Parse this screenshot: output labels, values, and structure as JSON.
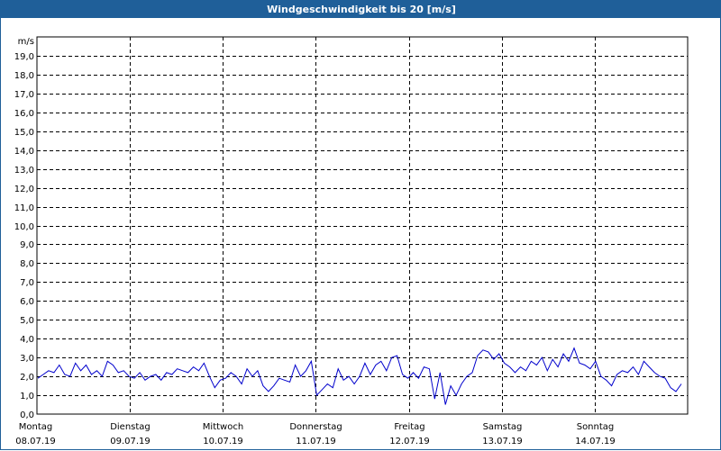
{
  "window": {
    "title": "Windgeschwindigkeit bis 20 [m/s]"
  },
  "colors": {
    "titlebar": "#1f5f99",
    "series": "#0000cc",
    "grid": "#000000"
  },
  "chart_data": {
    "type": "line",
    "title": "Windgeschwindigkeit bis 20 [m/s]",
    "ylabel": "m/s",
    "ylim": [
      0,
      20
    ],
    "yticks": [
      "0,0",
      "1,0",
      "2,0",
      "3,0",
      "4,0",
      "5,0",
      "6,0",
      "7,0",
      "8,0",
      "9,0",
      "10,0",
      "11,0",
      "12,0",
      "13,0",
      "14,0",
      "15,0",
      "16,0",
      "17,0",
      "18,0",
      "19,0"
    ],
    "grid": true,
    "x_days": [
      {
        "day": "Montag",
        "date": "08.07.19"
      },
      {
        "day": "Dienstag",
        "date": "09.07.19"
      },
      {
        "day": "Mittwoch",
        "date": "10.07.19"
      },
      {
        "day": "Donnerstag",
        "date": "11.07.19"
      },
      {
        "day": "Freitag",
        "date": "12.07.19"
      },
      {
        "day": "Samstag",
        "date": "13.07.19"
      },
      {
        "day": "Sonntag",
        "date": "14.07.19"
      }
    ],
    "series": [
      {
        "values": [
          1.9,
          2.1,
          2.3,
          2.2,
          2.6,
          2.1,
          2.0,
          2.7,
          2.3,
          2.6,
          2.1,
          2.3,
          2.0,
          2.8,
          2.6,
          2.2,
          2.3,
          2.0,
          1.9,
          2.2,
          1.8,
          2.0,
          2.1,
          1.8,
          2.2,
          2.1,
          2.4,
          2.3,
          2.2,
          2.5,
          2.3,
          2.7,
          2.0,
          1.4,
          1.8,
          1.9,
          2.2,
          2.0,
          1.6,
          2.4,
          2.0,
          2.3,
          1.5,
          1.2,
          1.5,
          1.9,
          1.8,
          1.7,
          2.6,
          2.0,
          2.3,
          2.8,
          1.0,
          1.3,
          1.6,
          1.4,
          2.4,
          1.8,
          2.0,
          1.6,
          2.0,
          2.7,
          2.1,
          2.6,
          2.8,
          2.3,
          3.0,
          3.1,
          2.1,
          1.9,
          2.2,
          1.9,
          2.5,
          2.4,
          0.8,
          2.2,
          0.5,
          1.5,
          1.0,
          1.6,
          2.0,
          2.2,
          3.1,
          3.4,
          3.3,
          2.9,
          3.2,
          2.7,
          2.5,
          2.2,
          2.5,
          2.3,
          2.8,
          2.6,
          3.0,
          2.3,
          2.9,
          2.5,
          3.2,
          2.8,
          3.5,
          2.7,
          2.6,
          2.4,
          2.8,
          2.0,
          1.8,
          1.5,
          2.1,
          2.3,
          2.2,
          2.5,
          2.1,
          2.8,
          2.5,
          2.2,
          2.0,
          1.9,
          1.4,
          1.2,
          1.6
        ]
      }
    ]
  }
}
